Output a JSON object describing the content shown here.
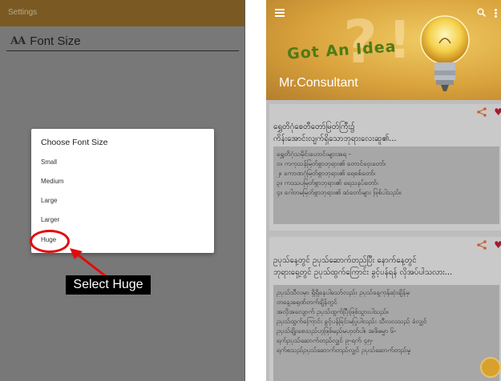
{
  "left_screen": {
    "appbar_title": "Settings",
    "pref_icon_text": "AA",
    "pref_label": "Font Size",
    "dialog": {
      "title": "Choose Font Size",
      "options": [
        "Small",
        "Medium",
        "Large",
        "Larger",
        "Huge"
      ]
    },
    "callout": "Select Huge",
    "highlight_color": "#e20b0b"
  },
  "right_screen": {
    "banner_text": "Got An Idea",
    "brand": "Mr.Consultant",
    "cards": [
      {
        "title_lines": [
          "ရွှေတိဂုံစေတီတော်မြတ်ကြီး၌",
          "ကိန်းအောင်းလျက်ရှိသောဘုရားလေးဆူ၏..."
        ],
        "body_lines": [
          "ရွှေတိဂုံသမိုင်းဟောင်းများအရ -",
          "၁။ ကကုသန်မြတ်စွာဘုရား၏ တောင်ဝှေးတော်၊",
          "၂။ ကောဏဂုံမြတ်စွာဘုရား၏ ရေစစ်တော်၊",
          "၃။ ကဿပမြတ်စွာဘုရား၏ ရေသနပ်တော်၊",
          "၄။ ဂေါတမမြတ်စွာဘုရား၏ ဆံတော်များ ဖြစ်ပါသည်။"
        ]
      },
      {
        "title_lines": [
          "ဥပုသ်နေ့တွင် ဥပုသ်ဆောက်တည်ပြီး နောက်နေ့တွင်",
          "ဘုရားရှေ့တွင် ဥပုသ်ထွက်ကြောင်း ခွင့်ပန်ရန် လိုအပ်ပါသလား..."
        ],
        "body_lines": [
          "ဥပုသ်သီလမှာ ရှိရှိနေပါသော်လည်း ဥပုသ်နေ့ကုန်ဆုံးချိန်မှ",
          "တနေ့အရုဏ်တက်ချိန်တွင်",
          "အလိုအလျောက် ဥပုသ်ထွက်ပြီးဖြစ်သွားပါသည်။",
          "ဥပုသ်ထွက်ကြောင်း ခွင့်ပန်ခြင်းမပြုပါလည်း သီလလသည် ခံလျှင်",
          "ဥပုသ်ချိုးစေသည်ဟုဖြစ်မည်မဟုတ်ပါ။ အဖိဓမ္မာ ၆-",
          "ရက်ဥပုသ်ဆောက်တည်လျှင် ၉-ရက် ၄၅-",
          "ရက်စသည်ဥပုသ်ဆောက်တည်လျှင် ဥပုသ်ဆောက်တည်မှု"
        ]
      }
    ]
  }
}
